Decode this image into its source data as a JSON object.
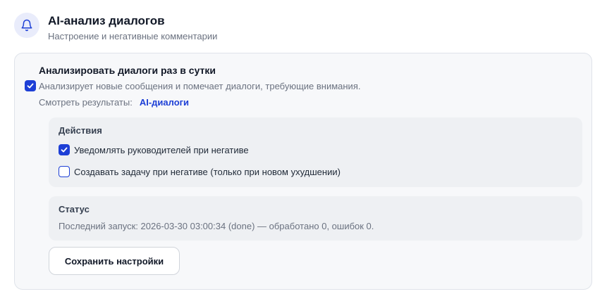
{
  "header": {
    "title": "AI-анализ диалогов",
    "subtitle": "Настроение и негативные комментарии",
    "icon": "bell-icon"
  },
  "card": {
    "title": "Анализировать диалоги раз в сутки",
    "enabled": true,
    "description": "Анализирует новые сообщения и помечает диалоги, требующие внимания.",
    "results_label": "Смотреть результаты:",
    "results_link": "AI-диалоги"
  },
  "actions": {
    "title": "Действия",
    "options": [
      {
        "label": "Уведомлять руководителей при негативе",
        "checked": true
      },
      {
        "label": "Создавать задачу при негативе (только при новом ухудшении)",
        "checked": false
      }
    ]
  },
  "status": {
    "title": "Статус",
    "text": "Последний запуск: 2026-03-30 03:00:34 (done) — обработано 0, ошибок 0."
  },
  "save_button": "Сохранить настройки",
  "colors": {
    "accent": "#1d3fd6",
    "icon_bg": "#e9ecfb",
    "card_bg": "#f7f8fa",
    "panel_bg": "#eef0f3"
  }
}
